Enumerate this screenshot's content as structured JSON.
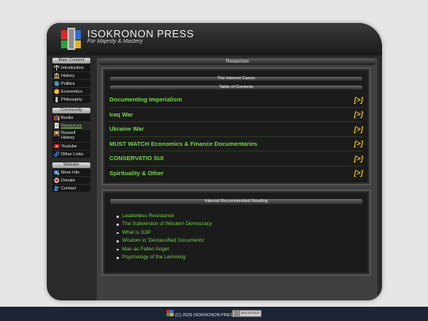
{
  "site": {
    "title": "ISOKRONON PRESS",
    "tagline": "For Majesty & Mastery",
    "logo_icon": "isokronon-logo-icon"
  },
  "sidebar": {
    "groups": [
      {
        "heading": "Main Content",
        "items": [
          {
            "label": "Introduction",
            "icon": "scales-icon"
          },
          {
            "label": "History",
            "icon": "parthenon-icon"
          },
          {
            "label": "Politics",
            "icon": "globe-icon"
          },
          {
            "label": "Economics",
            "icon": "coin-icon"
          },
          {
            "label": "Philosophy",
            "icon": "statue-icon"
          }
        ]
      },
      {
        "heading": "Community",
        "items": [
          {
            "label": "Books",
            "icon": "books-icon"
          },
          {
            "label": "Resources",
            "icon": "document-icon",
            "active": true
          },
          {
            "label": "Russell History",
            "icon": "portrait-icon"
          },
          {
            "label": "Youtube",
            "icon": "youtube-icon"
          },
          {
            "label": "Other Links",
            "icon": "link-icon"
          }
        ]
      },
      {
        "heading": "Website",
        "items": [
          {
            "label": "More Info",
            "icon": "info-icon"
          },
          {
            "label": "Donate",
            "icon": "donate-icon"
          },
          {
            "label": "Contact",
            "icon": "contact-icon"
          }
        ]
      }
    ]
  },
  "main": {
    "title": "Resources",
    "canon": {
      "heading": "The Internet Canon",
      "subheading": "Table of Contents",
      "arrow_label": "[>]",
      "items": [
        "Documenting Imperialism",
        "Iraq War",
        "Ukraine War",
        "MUST WATCH Economics & Finance Documentaries",
        "CONSERVATIO SUI",
        "Spirituality & Other"
      ]
    },
    "reading": {
      "heading": "Internet Recommended Reading",
      "items": [
        "Leaderless Resistance",
        "The Subversion of Western Democracy",
        "What is G3P",
        "Wisdom in 'Declassified Documents'",
        "Man as Fallen Angel",
        "Psychology of the Lemming"
      ]
    }
  },
  "footer": {
    "copyright": "(C) 2026 ISOKRONON PRESS",
    "badge_text": "WEB SERVER"
  },
  "colors": {
    "link_green": "#74d742",
    "arrow_yellow": "#f2c400",
    "footer_navy": "#1d2434"
  }
}
